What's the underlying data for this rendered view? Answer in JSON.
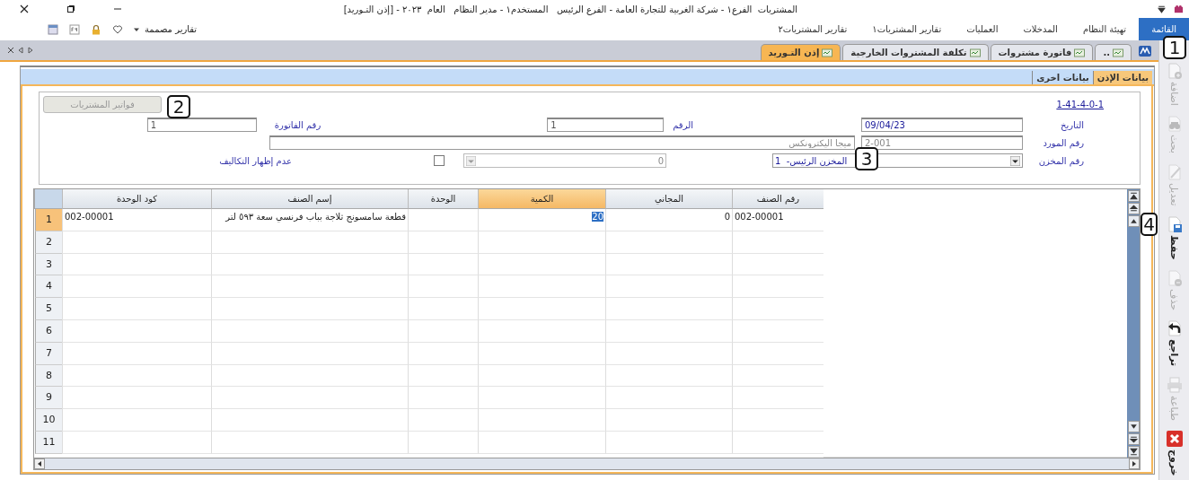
{
  "title_bar": {
    "title": "المشتريات  الفرع١ - شركة الغربية للتجارة العامة - الفرع الرئيس   المستخدم١ - مدير النظام   العام  ٢٠٢٣ - [إذن التـوريد]"
  },
  "menu": [
    {
      "label": "القائمة",
      "selected": true
    },
    {
      "label": "تهيئة النظام",
      "selected": false
    },
    {
      "label": "المدخلات",
      "selected": false
    },
    {
      "label": "العمليات",
      "selected": false
    },
    {
      "label": "تقارير المشتريات١",
      "selected": false
    },
    {
      "label": "تقارير المشتريات٢",
      "selected": false
    }
  ],
  "quick_toolbar": {
    "label": "تقارير مصممة"
  },
  "doc_tabs": [
    {
      "label": "..",
      "selected": false
    },
    {
      "label": "فاتورة مشتروات",
      "selected": false
    },
    {
      "label": "تكلفة المشتروات الخارجية",
      "selected": false
    },
    {
      "label": "إذن التـوريد",
      "selected": true
    }
  ],
  "form_tabs": [
    {
      "label": "بيانات الإذن",
      "selected": true
    },
    {
      "label": "بيانات اخرى",
      "selected": false
    }
  ],
  "form": {
    "code_link": "1-41-4-0-1",
    "invoices_button": {
      "label": "فواتير المشتريات",
      "disabled": true
    },
    "date": {
      "label": "التاريخ",
      "value": "09/04/23"
    },
    "number": {
      "label": "الرقم",
      "value": "1"
    },
    "invoice_number": {
      "label": "رقم الفاتورة",
      "value": "1"
    },
    "supplier": {
      "label": "رقم المورد",
      "value": "2-001",
      "name": "ميجا اليكترونكس"
    },
    "warehouse": {
      "label": "رقم المخزن",
      "value": "المخزن الرئيس-  1",
      "secondary_value": "0"
    },
    "hide_costs": {
      "label": "عدم إظهار التكاليف",
      "checked": false
    }
  },
  "grid": {
    "columns": [
      {
        "label": "رقم الصنف",
        "selected": false
      },
      {
        "label": "المجاني",
        "selected": false
      },
      {
        "label": "الكمية",
        "selected": true
      },
      {
        "label": "الوحدة",
        "selected": false
      },
      {
        "label": "إسم الصنف",
        "selected": false
      },
      {
        "label": "كود الوحدة",
        "selected": false
      }
    ],
    "rows": [
      {
        "number": "1",
        "selected": true,
        "cells": [
          "002-00001",
          "0",
          "20",
          "",
          "قطعة سامسونج ثلاجة بباب فرنسي سعة ٥٩٣ لتر",
          "002-00001"
        ]
      },
      {
        "number": "2",
        "selected": false,
        "cells": []
      },
      {
        "number": "3",
        "selected": false,
        "cells": []
      },
      {
        "number": "4",
        "selected": false,
        "cells": []
      },
      {
        "number": "5",
        "selected": false,
        "cells": []
      },
      {
        "number": "6",
        "selected": false,
        "cells": []
      },
      {
        "number": "7",
        "selected": false,
        "cells": []
      },
      {
        "number": "8",
        "selected": false,
        "cells": []
      },
      {
        "number": "9",
        "selected": false,
        "cells": []
      },
      {
        "number": "10",
        "selected": false,
        "cells": []
      },
      {
        "number": "11",
        "selected": false,
        "cells": []
      }
    ]
  },
  "side_toolbar": [
    {
      "kind": "add",
      "label": "اضافة",
      "disabled": true
    },
    {
      "kind": "search",
      "label": "بحث",
      "disabled": true
    },
    {
      "kind": "edit",
      "label": "تعديل",
      "disabled": true
    },
    {
      "kind": "save",
      "label": "حفظ",
      "disabled": false
    },
    {
      "kind": "delete",
      "label": "حذف",
      "disabled": true
    },
    {
      "kind": "undo",
      "label": "تراجع",
      "disabled": false
    },
    {
      "kind": "print",
      "label": "طباعة",
      "disabled": true
    },
    {
      "kind": "exit",
      "label": "خروج",
      "disabled": false
    }
  ],
  "callouts": [
    {
      "label": "1"
    },
    {
      "label": "2"
    },
    {
      "label": "3"
    },
    {
      "label": "4"
    }
  ]
}
